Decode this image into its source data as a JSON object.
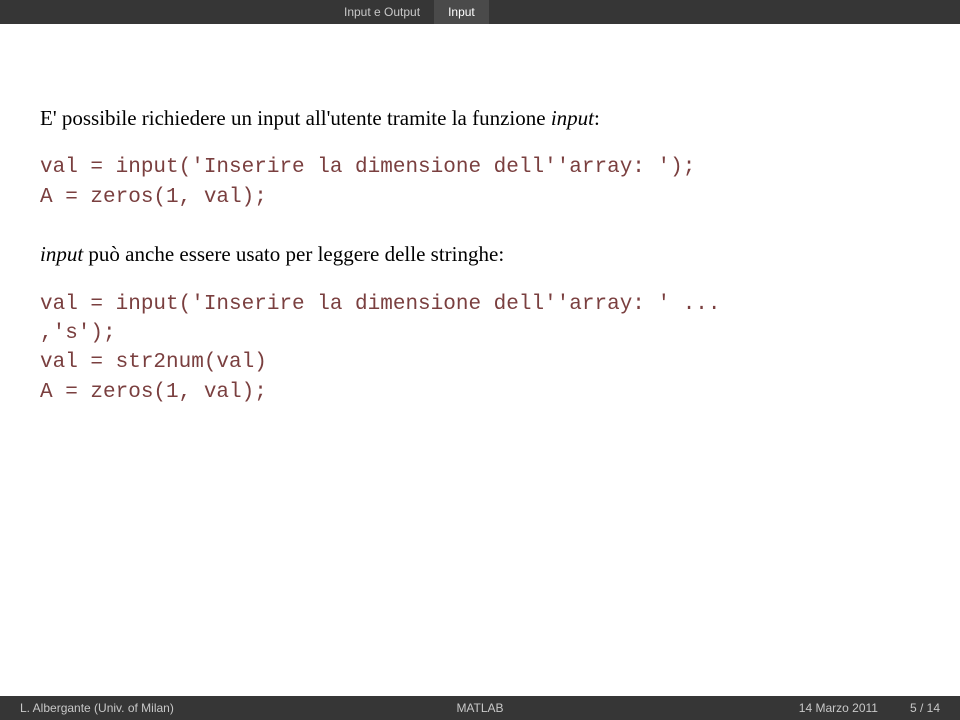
{
  "topbar": {
    "tabs": [
      {
        "label": "Input e Output"
      },
      {
        "label": "Input"
      }
    ]
  },
  "content": {
    "para1_prefix": "E' possibile richiedere un input all'utente tramite la funzione ",
    "para1_func": "input",
    "para1_suffix": ":",
    "code1": "val = input('Inserire la dimensione dell''array: ');\nA = zeros(1, val);",
    "para2_func": "input",
    "para2_suffix": " può anche essere usato per leggere delle stringhe:",
    "code2": "val = input('Inserire la dimensione dell''array: ' ...\n,'s');\nval = str2num(val)\nA = zeros(1, val);"
  },
  "footer": {
    "author": "L. Albergante (Univ. of Milan)",
    "title": "MATLAB",
    "date": "14 Marzo 2011",
    "page": "5 / 14"
  }
}
